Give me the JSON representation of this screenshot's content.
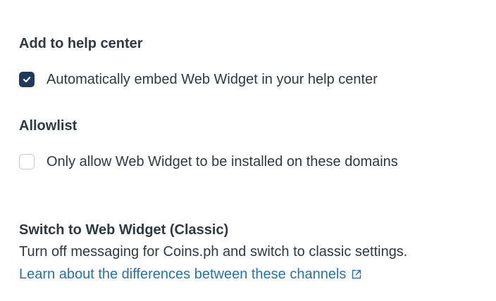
{
  "help_center": {
    "heading": "Add to help center",
    "embed_checkbox": {
      "label": "Automatically embed Web Widget in your help center",
      "checked": true
    }
  },
  "allowlist": {
    "heading": "Allowlist",
    "domains_checkbox": {
      "label": "Only allow Web Widget to be installed on these domains",
      "checked": false
    }
  },
  "classic": {
    "title": "Switch to Web Widget (Classic)",
    "description": "Turn off messaging for Coins.ph and switch to classic settings.",
    "link_text": "Learn about the differences between these channels",
    "link_icon": "external-link-icon"
  },
  "colors": {
    "text": "#2f3941",
    "checkbox_checked": "#1f3a5f",
    "checkbox_border": "#c2c8cc",
    "link": "#1f73b7"
  }
}
